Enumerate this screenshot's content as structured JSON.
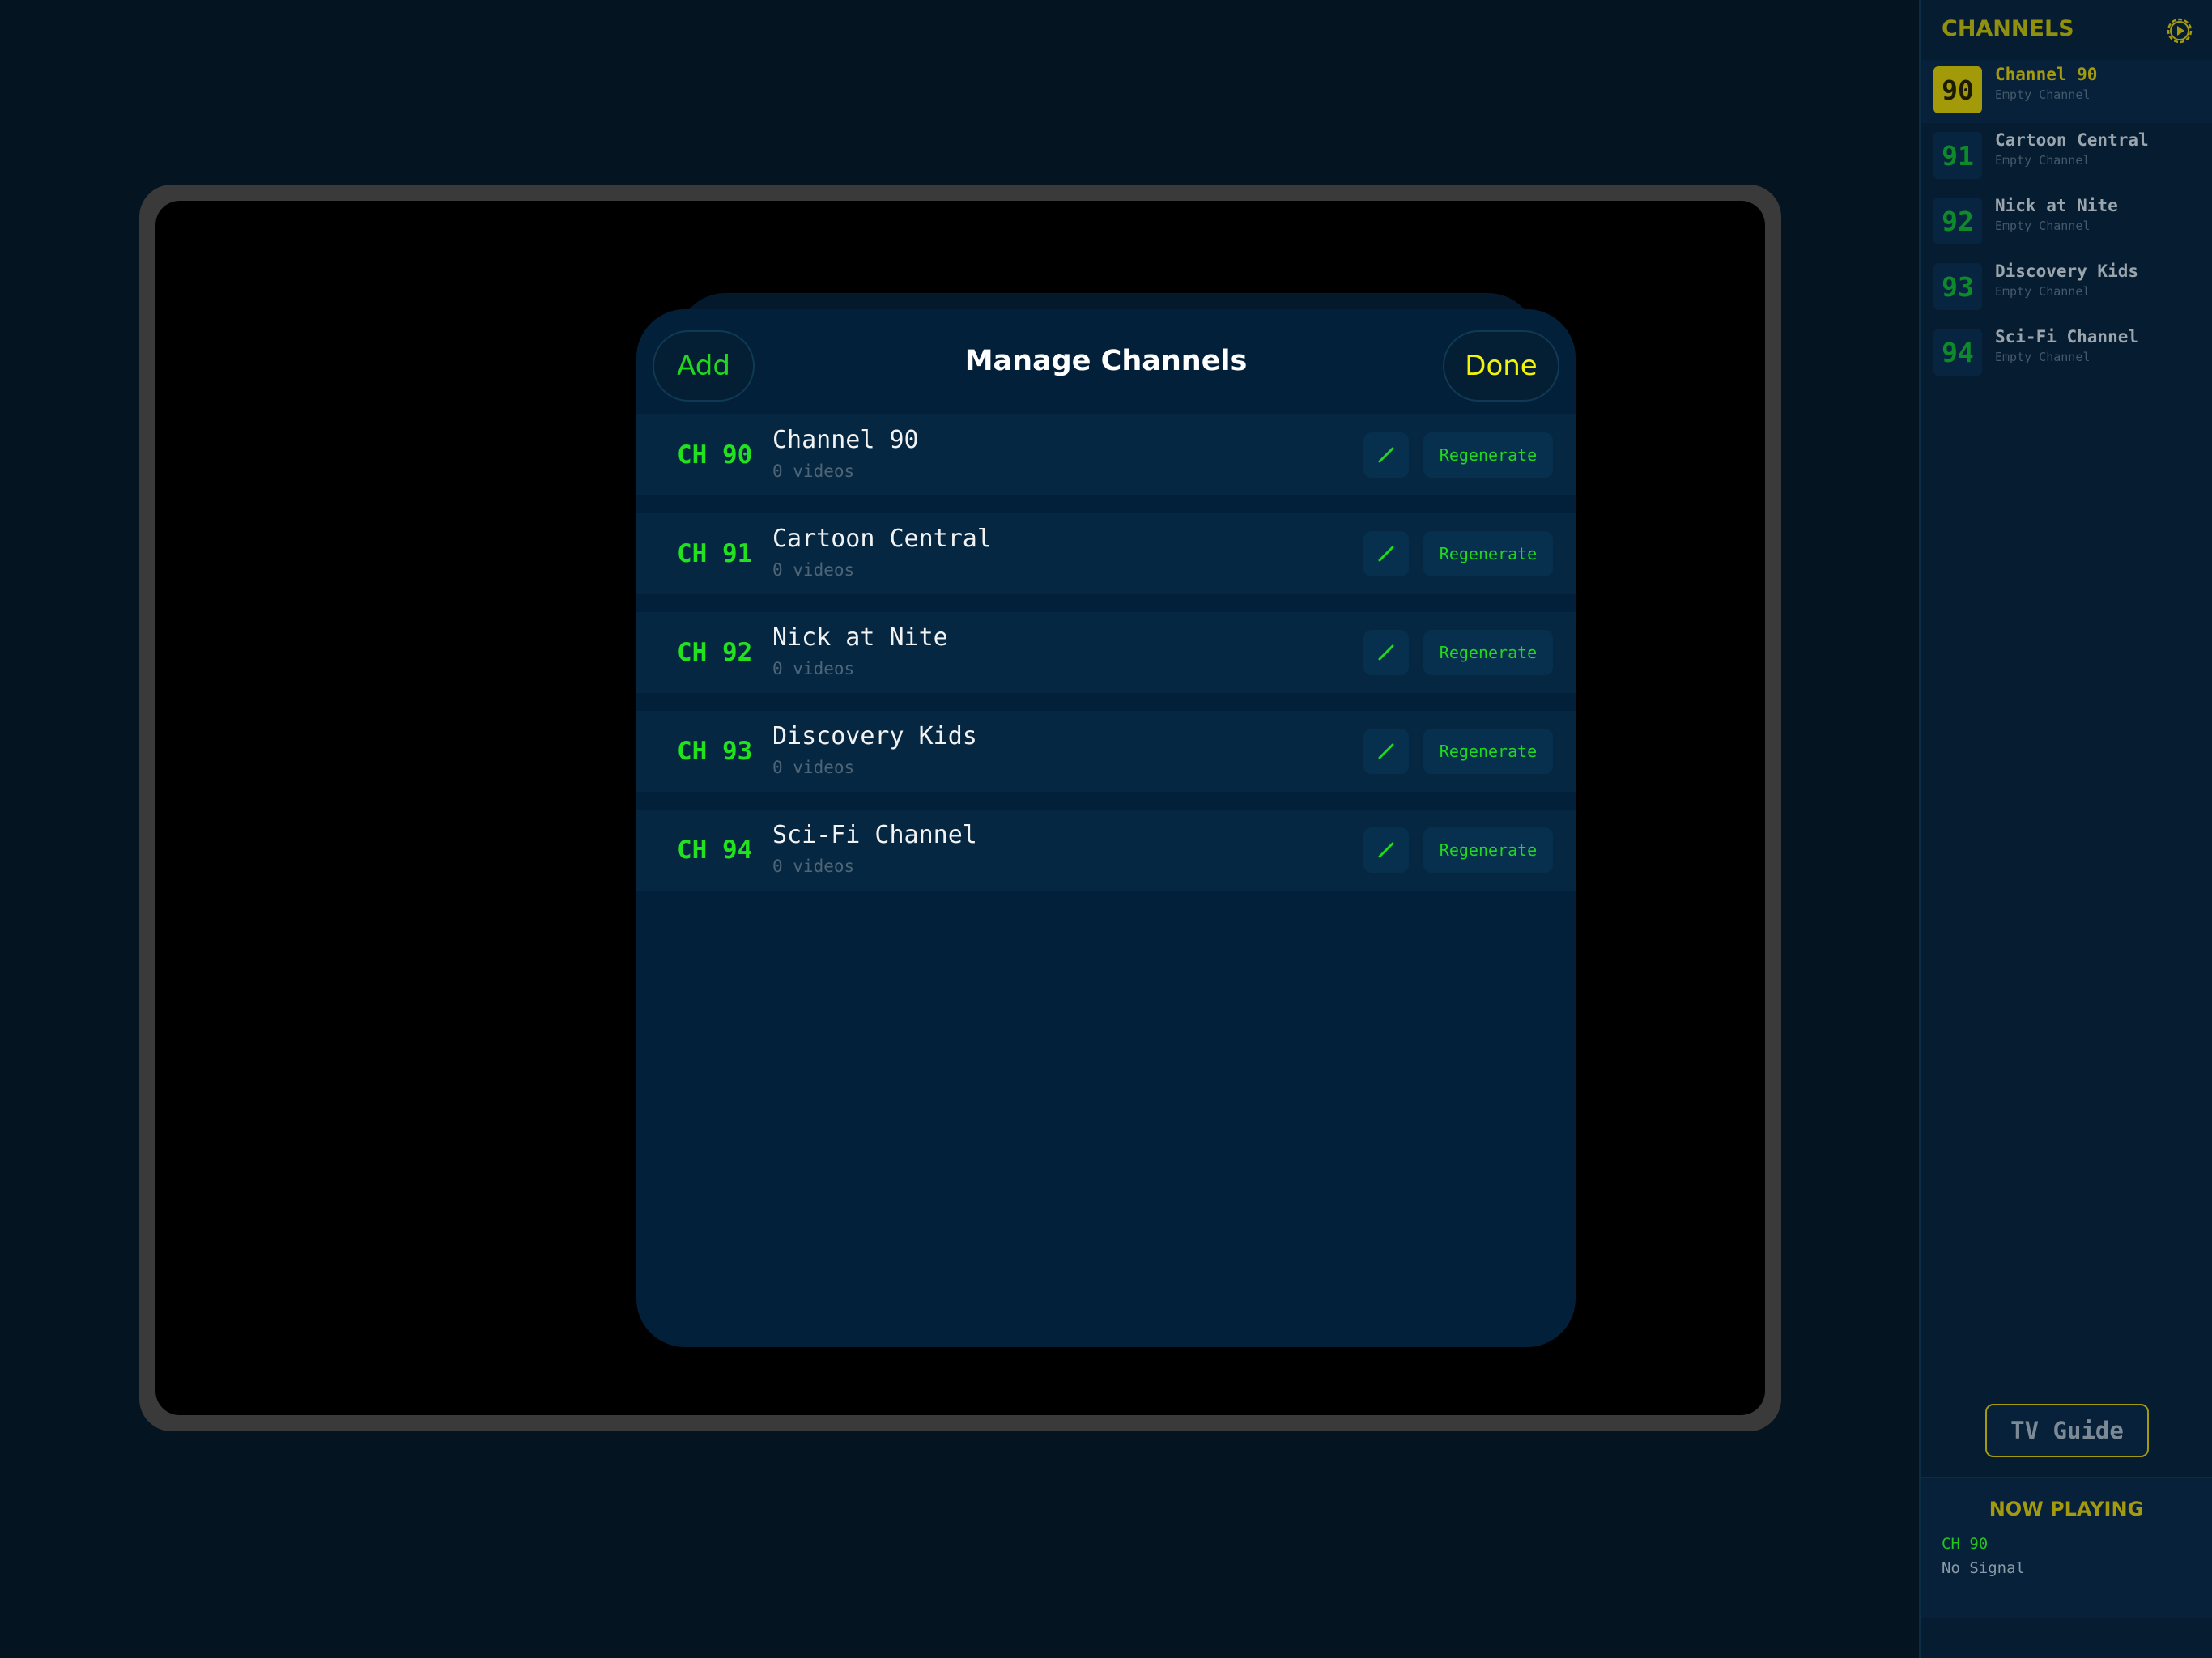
{
  "modal": {
    "title": "Manage Channels",
    "add_label": "Add",
    "done_label": "Done",
    "channels": [
      {
        "num": "CH 90",
        "name": "Channel 90",
        "videos": "0 videos",
        "action": "Regenerate"
      },
      {
        "num": "CH 91",
        "name": "Cartoon Central",
        "videos": "0 videos",
        "action": "Regenerate"
      },
      {
        "num": "CH 92",
        "name": "Nick at Nite",
        "videos": "0 videos",
        "action": "Regenerate"
      },
      {
        "num": "CH 93",
        "name": "Discovery Kids",
        "videos": "0 videos",
        "action": "Regenerate"
      },
      {
        "num": "CH 94",
        "name": "Sci-Fi Channel",
        "videos": "0 videos",
        "action": "Regenerate"
      }
    ]
  },
  "sidebar": {
    "title": "CHANNELS",
    "settings_icon": "gear-play-icon",
    "items": [
      {
        "num": "90",
        "name": "Channel 90",
        "sub": "Empty Channel"
      },
      {
        "num": "91",
        "name": "Cartoon Central",
        "sub": "Empty Channel"
      },
      {
        "num": "92",
        "name": "Nick at Nite",
        "sub": "Empty Channel"
      },
      {
        "num": "93",
        "name": "Discovery Kids",
        "sub": "Empty Channel"
      },
      {
        "num": "94",
        "name": "Sci-Fi Channel",
        "sub": "Empty Channel"
      }
    ],
    "tv_guide_label": "TV Guide",
    "now_playing": {
      "title": "NOW PLAYING",
      "channel": "CH 90",
      "status": "No Signal"
    }
  },
  "colors": {
    "accent_green": "#22d81f",
    "accent_yellow": "#f2f20a",
    "background": "#041421"
  }
}
